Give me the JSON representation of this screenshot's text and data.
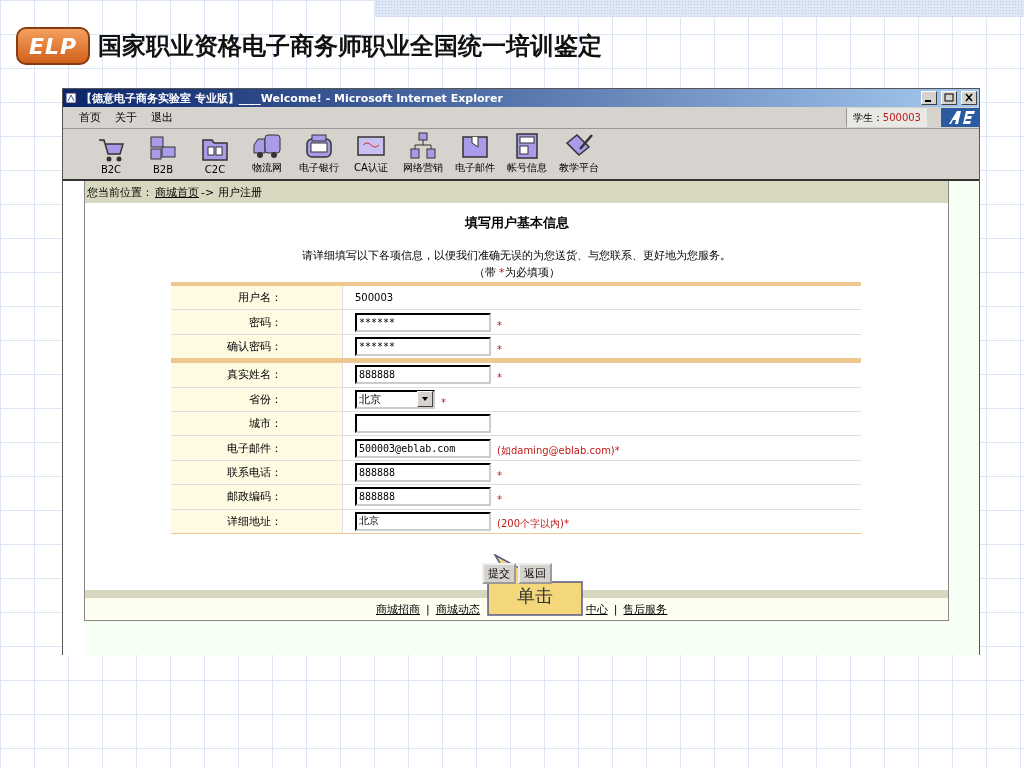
{
  "slide": {
    "logo_text": "ELP",
    "title": "国家职业资格电子商务师职业全国统一培训鉴定"
  },
  "window": {
    "title": "【德意电子商务实验室 专业版】____Welcome! - Microsoft Internet Explorer"
  },
  "menu": [
    "首页",
    "关于",
    "退出"
  ],
  "user": {
    "label": "学生：",
    "id": "500003"
  },
  "toolbar": [
    {
      "label": "B2C"
    },
    {
      "label": "B2B"
    },
    {
      "label": "C2C"
    },
    {
      "label": "物流网"
    },
    {
      "label": "电子银行"
    },
    {
      "label": "CA认证"
    },
    {
      "label": "网络营销"
    },
    {
      "label": "电子邮件"
    },
    {
      "label": "帐号信息"
    },
    {
      "label": "教学平台"
    }
  ],
  "breadcrumb": {
    "prefix": "您当前位置：",
    "link": "商城首页",
    "current": "-> 用户注册"
  },
  "form": {
    "title": "填写用户基本信息",
    "intro": "请详细填写以下各项信息，以便我们准确无误的为您送货、与您联系、更好地为您服务。",
    "required_hint": {
      "before": "（带 ",
      "mark": "*",
      "after": "为必填项）"
    },
    "sections": [
      [
        {
          "label": "用户名：",
          "kind": "static",
          "value": "500003"
        },
        {
          "label": "密码：",
          "kind": "input",
          "value": "******",
          "note": "*"
        },
        {
          "label": "确认密码：",
          "kind": "input",
          "value": "******",
          "note": "*"
        }
      ],
      [
        {
          "label": "真实姓名：",
          "kind": "input",
          "value": "888888",
          "note": "*"
        },
        {
          "label": "省份：",
          "kind": "select",
          "value": "北京",
          "note": "*"
        },
        {
          "label": "城市：",
          "kind": "input"
        },
        {
          "label": "电子邮件：",
          "kind": "input",
          "value": "500003@eblab.com",
          "note": "(如daming@eblab.com)*"
        },
        {
          "label": "联系电话：",
          "kind": "input",
          "value": "888888",
          "note": "*"
        },
        {
          "label": "邮政编码：",
          "kind": "input",
          "value": "888888",
          "note": "*"
        },
        {
          "label": "详细地址：",
          "kind": "input",
          "value": "北京",
          "note": "(200个字以内)*"
        }
      ]
    ]
  },
  "buttons": [
    "提交",
    "返回"
  ],
  "callout": "单击",
  "footer": {
    "separator": "|",
    "links_left": [
      "商城招商",
      "商城动态"
    ],
    "links_right": [
      "中心",
      "售后服务"
    ]
  }
}
